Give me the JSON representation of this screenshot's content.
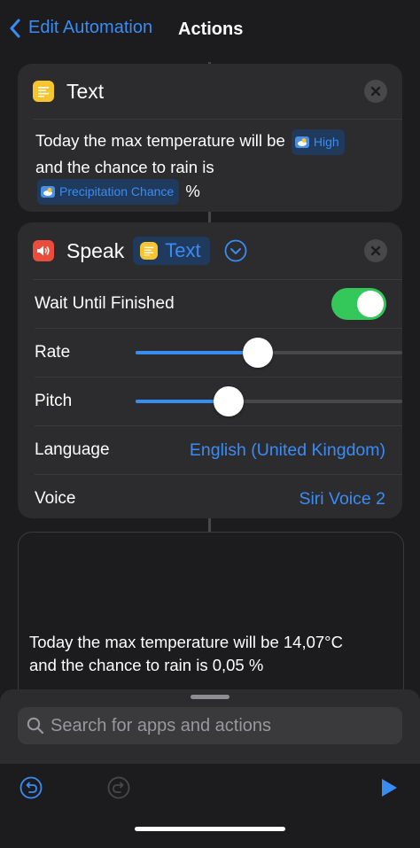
{
  "nav": {
    "back_label": "Edit Automation",
    "title": "Actions"
  },
  "text_action": {
    "title": "Text",
    "icon": "text-doc-icon",
    "line1": "Today the max temperature will be",
    "token_high": "High",
    "line2": "and the chance to rain is",
    "token_precip": "Precipitation Chance",
    "suffix": "%"
  },
  "speak_action": {
    "title": "Speak",
    "icon": "speaker-icon",
    "param_token": "Text",
    "rows": {
      "wait": {
        "label": "Wait Until Finished",
        "on": true
      },
      "rate": {
        "label": "Rate",
        "level": 0.46
      },
      "pitch": {
        "label": "Pitch",
        "level": 0.35
      },
      "language": {
        "label": "Language",
        "value": "English (United Kingdom)"
      },
      "voice": {
        "label": "Voice",
        "value": "Siri Voice 2"
      }
    }
  },
  "output": {
    "line1": "Today the max temperature will be  14,07°C",
    "line2": "and the chance to rain is  0,05 %"
  },
  "search": {
    "placeholder": "Search for apps and actions"
  },
  "colors": {
    "accent": "#3a8cf5",
    "toggle_on": "#34c759",
    "card": "#2c2c2e",
    "background": "#1c1c1e"
  }
}
